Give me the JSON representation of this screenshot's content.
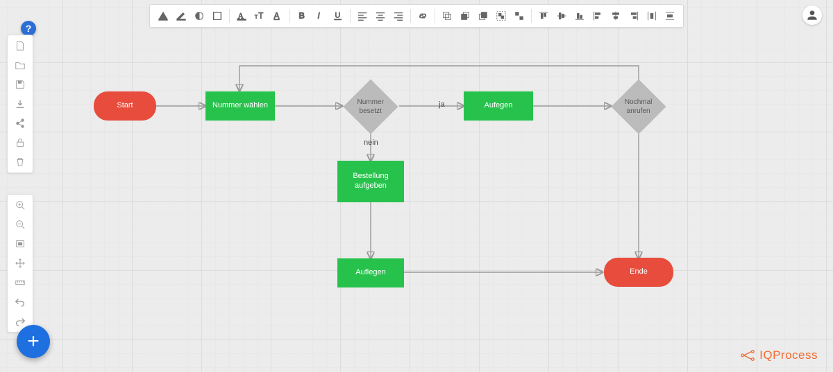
{
  "toolbar": {
    "groups": [
      [
        "fill-color-icon",
        "line-color-icon",
        "opacity-icon",
        "border-style-icon"
      ],
      [
        "font-color-icon",
        "font-size-icon",
        "font-family-icon"
      ],
      [
        "bold-icon",
        "italic-icon",
        "underline-icon"
      ],
      [
        "align-left-icon",
        "align-center-icon",
        "align-right-icon"
      ],
      [
        "link-icon"
      ],
      [
        "copy-icon",
        "to-front-icon",
        "to-back-icon",
        "group-icon",
        "ungroup-icon"
      ],
      [
        "align-top-icon",
        "align-vcenter-icon",
        "align-bottom-icon",
        "align-hleft-icon",
        "align-hcenter-icon",
        "align-hright-icon",
        "distribute-h-icon",
        "distribute-v-icon"
      ]
    ]
  },
  "side_panel_1": [
    "new-file-icon",
    "folder-icon",
    "save-icon",
    "download-icon",
    "share-icon",
    "lock-icon",
    "trash-icon"
  ],
  "side_panel_2": [
    "zoom-in-icon",
    "zoom-out-icon",
    "fit-screen-icon",
    "pan-icon",
    "ruler-icon",
    "undo-icon",
    "redo-icon"
  ],
  "help_label": "?",
  "fab_label": "+",
  "avatar": "user-avatar",
  "logo_text": "IQProcess",
  "nodes": {
    "start": {
      "label": "Start",
      "type": "terminal"
    },
    "dial": {
      "label": "Nummer wählen",
      "type": "process"
    },
    "busy": {
      "label": "Nummer besetzt",
      "type": "decision"
    },
    "hangup1": {
      "label": "Aufegen",
      "type": "process"
    },
    "again": {
      "label": "Nochmal anrufen",
      "type": "decision"
    },
    "order": {
      "label": "Bestellung aufgeben",
      "type": "process"
    },
    "hangup2": {
      "label": "Auflegen",
      "type": "process"
    },
    "end": {
      "label": "Ende",
      "type": "terminal"
    }
  },
  "edge_labels": {
    "yes": "ja",
    "no": "nein"
  },
  "edges": [
    {
      "from": "start",
      "to": "dial"
    },
    {
      "from": "dial",
      "to": "busy"
    },
    {
      "from": "busy",
      "to": "hangup1",
      "label": "ja"
    },
    {
      "from": "busy",
      "to": "order",
      "label": "nein"
    },
    {
      "from": "hangup1",
      "to": "again"
    },
    {
      "from": "again",
      "to": "dial",
      "route": "top-back"
    },
    {
      "from": "again",
      "to": "end"
    },
    {
      "from": "order",
      "to": "hangup2"
    },
    {
      "from": "hangup2",
      "to": "end"
    }
  ]
}
